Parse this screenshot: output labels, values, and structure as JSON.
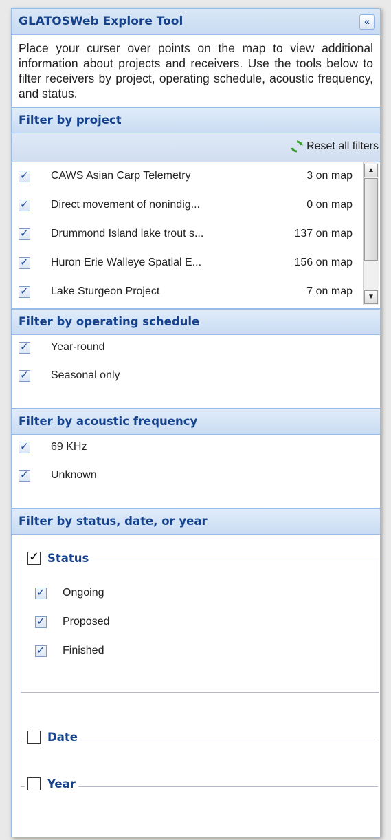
{
  "panel": {
    "title": "GLATOSWeb Explore Tool",
    "collapse_glyph": "«",
    "intro": "Place your curser over points on the map to view additional information about projects and receivers. Use the tools below to filter receivers by project, operating schedule, acoustic frequency, and status."
  },
  "project_filter": {
    "heading": "Filter by project",
    "reset_label": "Reset all filters",
    "reset_icon": "refresh-icon",
    "items": [
      {
        "name": "CAWS Asian Carp Telemetry",
        "count": "3 on map",
        "checked": true
      },
      {
        "name": "Direct movement of nonindig...",
        "count": "0 on map",
        "checked": true
      },
      {
        "name": "Drummond Island lake trout s...",
        "count": "137 on map",
        "checked": true
      },
      {
        "name": "Huron Erie Walleye Spatial E...",
        "count": "156 on map",
        "checked": true
      },
      {
        "name": "Lake Sturgeon Project",
        "count": "7 on map",
        "checked": true
      }
    ]
  },
  "schedule_filter": {
    "heading": "Filter by operating schedule",
    "items": [
      {
        "label": "Year-round",
        "checked": true
      },
      {
        "label": "Seasonal only",
        "checked": true
      }
    ]
  },
  "frequency_filter": {
    "heading": "Filter by acoustic frequency",
    "items": [
      {
        "label": "69 KHz",
        "checked": true
      },
      {
        "label": "Unknown",
        "checked": true
      }
    ]
  },
  "status_filter": {
    "heading": "Filter by status, date, or year",
    "status_group": {
      "label": "Status",
      "checked": true,
      "items": [
        {
          "label": "Ongoing",
          "checked": true
        },
        {
          "label": "Proposed",
          "checked": true
        },
        {
          "label": "Finished",
          "checked": true
        }
      ]
    },
    "date_group": {
      "label": "Date",
      "checked": false
    },
    "year_group": {
      "label": "Year",
      "checked": false
    }
  },
  "colors": {
    "header_text": "#15428b",
    "border": "#99bbe8",
    "refresh_icon": "#3aa12e"
  }
}
